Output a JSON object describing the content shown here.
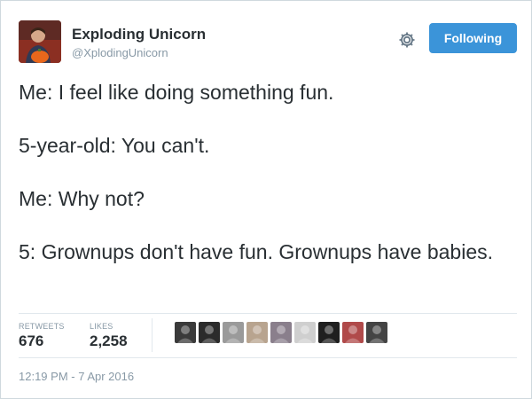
{
  "author": {
    "name": "Exploding Unicorn",
    "handle": "@XplodingUnicorn",
    "avatar_icon": "user-avatar"
  },
  "actions": {
    "settings_icon": "gear-icon",
    "follow_label": "Following",
    "follow_color": "#3b94d9"
  },
  "tweet": {
    "lines": [
      "Me: I feel like doing something fun.",
      "5-year-old: You can't.",
      "Me: Why not?",
      "5: Grownups don't have fun. Grownups have babies."
    ]
  },
  "stats": {
    "retweets_label": "RETWEETS",
    "retweets_count": "676",
    "likes_label": "LIKES",
    "likes_count": "2,258"
  },
  "likers": [
    {
      "name": "liker-avatar-1",
      "color": "#3a3a3a"
    },
    {
      "name": "liker-avatar-2",
      "color": "#2b2b2b"
    },
    {
      "name": "liker-avatar-3",
      "color": "#9a9a9a"
    },
    {
      "name": "liker-avatar-4",
      "color": "#b8a48f"
    },
    {
      "name": "liker-avatar-5",
      "color": "#8a7f8c"
    },
    {
      "name": "liker-avatar-6",
      "color": "#cfcfcf"
    },
    {
      "name": "liker-avatar-7",
      "color": "#1f1f1f"
    },
    {
      "name": "liker-avatar-8",
      "color": "#b04a4a"
    },
    {
      "name": "liker-avatar-9",
      "color": "#444444"
    }
  ],
  "timestamp": "12:19 PM - 7 Apr 2016"
}
